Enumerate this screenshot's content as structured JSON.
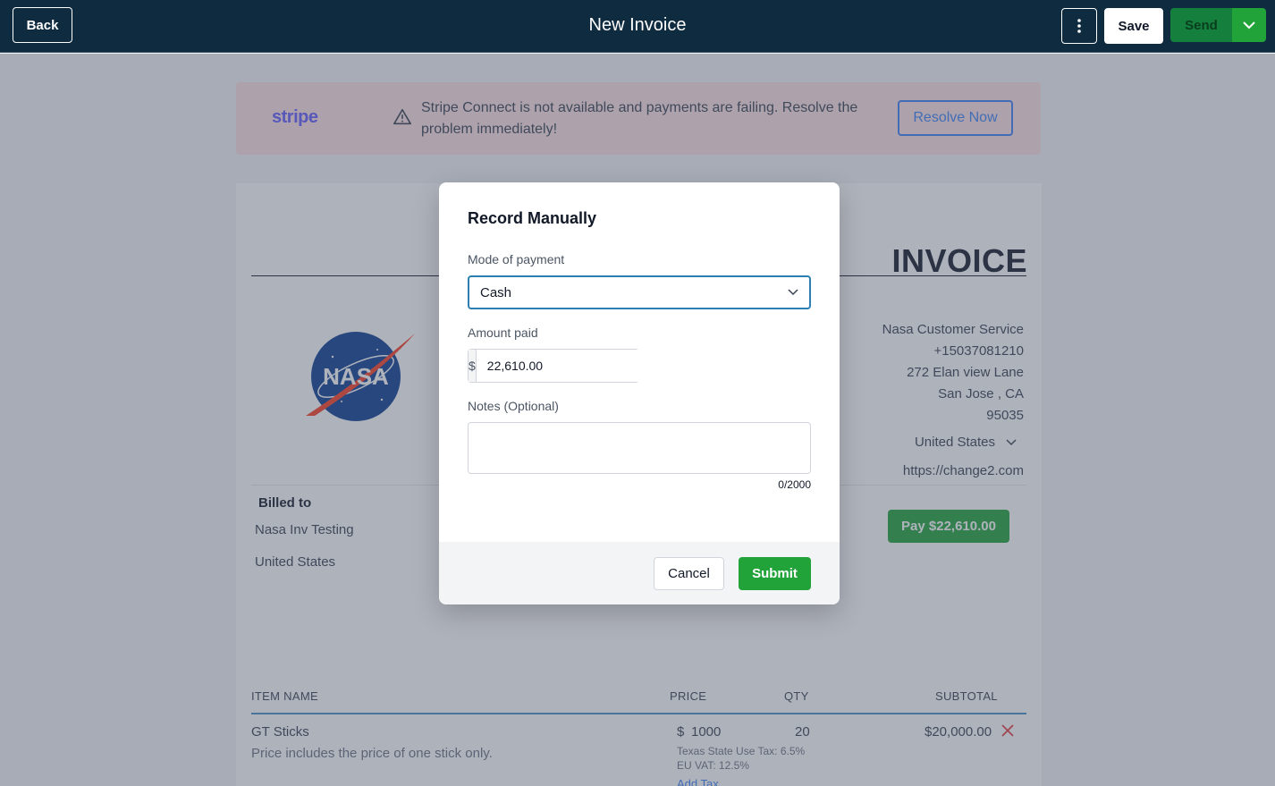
{
  "topbar": {
    "title": "New Invoice",
    "back_label": "Back",
    "save_label": "Save",
    "send_label": "Send"
  },
  "alert": {
    "brand": "stripe",
    "message": "Stripe Connect is not available and payments are failing. Resolve the problem immediately!",
    "action_label": "Resolve Now"
  },
  "invoice": {
    "heading": "INVOICE",
    "logo_text": "NASA",
    "company": {
      "name": "Nasa Customer Service",
      "phone": "+15037081210",
      "address": "272 Elan view Lane",
      "city_state": "San Jose , CA",
      "zip": "95035",
      "country": "United States",
      "website": "https://change2.com"
    },
    "billed_to": {
      "label": "Billed to",
      "name": "Nasa Inv Testing",
      "country": "United States"
    },
    "pay_button_label": "Pay $22,610.00",
    "table": {
      "headers": [
        "ITEM NAME",
        "PRICE",
        "QTY",
        "SUBTOTAL"
      ],
      "rows": [
        {
          "name": "GT Sticks",
          "description": "Price includes the price of one stick only.",
          "currency": "$",
          "price": "1000",
          "qty": "20",
          "subtotal": "$20,000.00",
          "taxes": [
            "Texas State Use Tax: 6.5%",
            "EU VAT: 12.5%"
          ],
          "add_tax_label": "Add Tax"
        }
      ]
    }
  },
  "modal": {
    "title": "Record Manually",
    "mode_label": "Mode of payment",
    "mode_value": "Cash",
    "amount_label": "Amount paid",
    "currency_symbol": "$",
    "amount_value": "22,610.00",
    "notes_label": "Notes (Optional)",
    "notes_counter": "0/2000",
    "cancel_label": "Cancel",
    "submit_label": "Submit"
  },
  "colors": {
    "topbar_bg": "#0f2b3f",
    "primary_green": "#22a33a",
    "focus_blue": "#2b7fb3",
    "stripe_purple": "#635bff"
  }
}
